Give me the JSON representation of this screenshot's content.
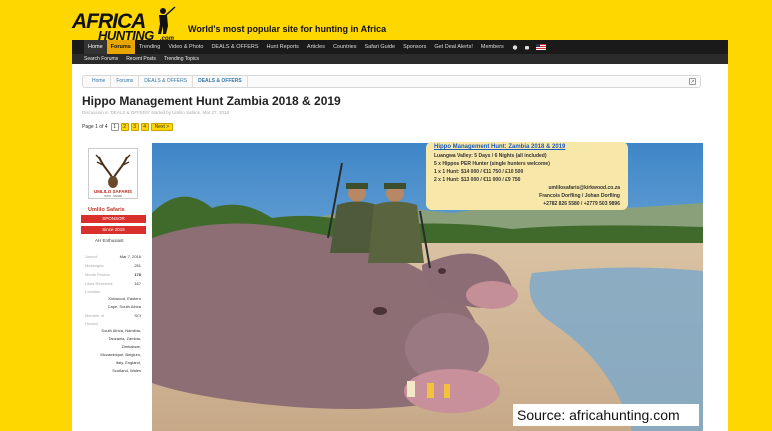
{
  "brand": {
    "logo_top": "AFRICA",
    "logo_bottom": "HUNTING",
    "logo_suffix": ".com",
    "tagline": "World's most popular site for hunting in Africa"
  },
  "navbar": {
    "items": [
      {
        "label": "Home"
      },
      {
        "label": "Forums"
      },
      {
        "label": "Trending"
      },
      {
        "label": "Video & Photo"
      },
      {
        "label": "DEALS & OFFERS"
      },
      {
        "label": "Hunt Reports"
      },
      {
        "label": "Articles"
      },
      {
        "label": "Countries"
      },
      {
        "label": "Safari Guide"
      },
      {
        "label": "Sponsors"
      },
      {
        "label": "Get Deal Alerts!"
      },
      {
        "label": "Members"
      }
    ]
  },
  "subnav": {
    "items": [
      {
        "label": "Search Forums"
      },
      {
        "label": "Recent Posts"
      },
      {
        "label": "Trending Topics"
      }
    ]
  },
  "breadcrumb": {
    "items": [
      {
        "label": "Home"
      },
      {
        "label": "Forums"
      },
      {
        "label": "DEALS & OFFERS"
      },
      {
        "label": "DEALS & OFFERS"
      }
    ],
    "exit_icon": "↗"
  },
  "thread": {
    "title": "Hippo Management Hunt Zambia 2018 & 2019",
    "meta": "Discussion in 'DEALS & OFFERS' started by Umlilo Safaris, Mar 27, 2018."
  },
  "pager": {
    "label": "Page 1 of 4",
    "pages": [
      "1",
      "2",
      "3",
      "4"
    ],
    "next": "Next >"
  },
  "sidebar": {
    "avatar_caption": "UMLILO SAFARIS",
    "avatar_sub": "HUNT · SAFARI",
    "name": "Umlilo Safaris",
    "ribbon1": "SPONSOR",
    "ribbon2": "Since 2016",
    "user_title": "AH Enthusiast",
    "stats": [
      {
        "k": "Joined:",
        "v": "Mar 7, 2016"
      },
      {
        "k": "Messages:",
        "v": "251"
      },
      {
        "k": "Media Photos:",
        "v": "178"
      },
      {
        "k": "Likes Received:",
        "v": "167"
      }
    ],
    "location_label": "Location:",
    "location": [
      "Kirkwood, Eastern",
      "Cape, South Africa"
    ],
    "member_of_label": "Member of",
    "member_of": "SCI",
    "hunted_label": "Hunted",
    "hunted": [
      "South Africa, Namibia,",
      "Tanzania, Zambia,",
      "Zimbabwe,",
      "Mozambique, Belgium,",
      "Italy, England,",
      "Scotland, Wales"
    ]
  },
  "infobox": {
    "heading": "Hippo Management Hunt: Zambia 2018 & 2019",
    "lines": [
      "Luangwa Valley:  5 Days / 6 Nights (all included)",
      "5 x Hippos PER Hunter (single hunters welcome)",
      "1 x 1 Hunt:  $14 000 / €11 750 / £10 500",
      "2 x 1 Hunt:  $13 000 / €11 000 / £9 750"
    ],
    "contact": [
      "umlilosafaris@kirkwood.co.za",
      "Francois Dorfling / Johan Dorfling",
      "+2782 826 5580 / +2779 503 9896"
    ]
  },
  "watermark": "Source: africahunting.com",
  "colors": {
    "brand_yellow": "#ffd700",
    "nav_dark": "#1a1a1a",
    "nav_active": "#e8a600",
    "sponsor_red": "#d9302c",
    "link_blue": "#3377aa"
  }
}
